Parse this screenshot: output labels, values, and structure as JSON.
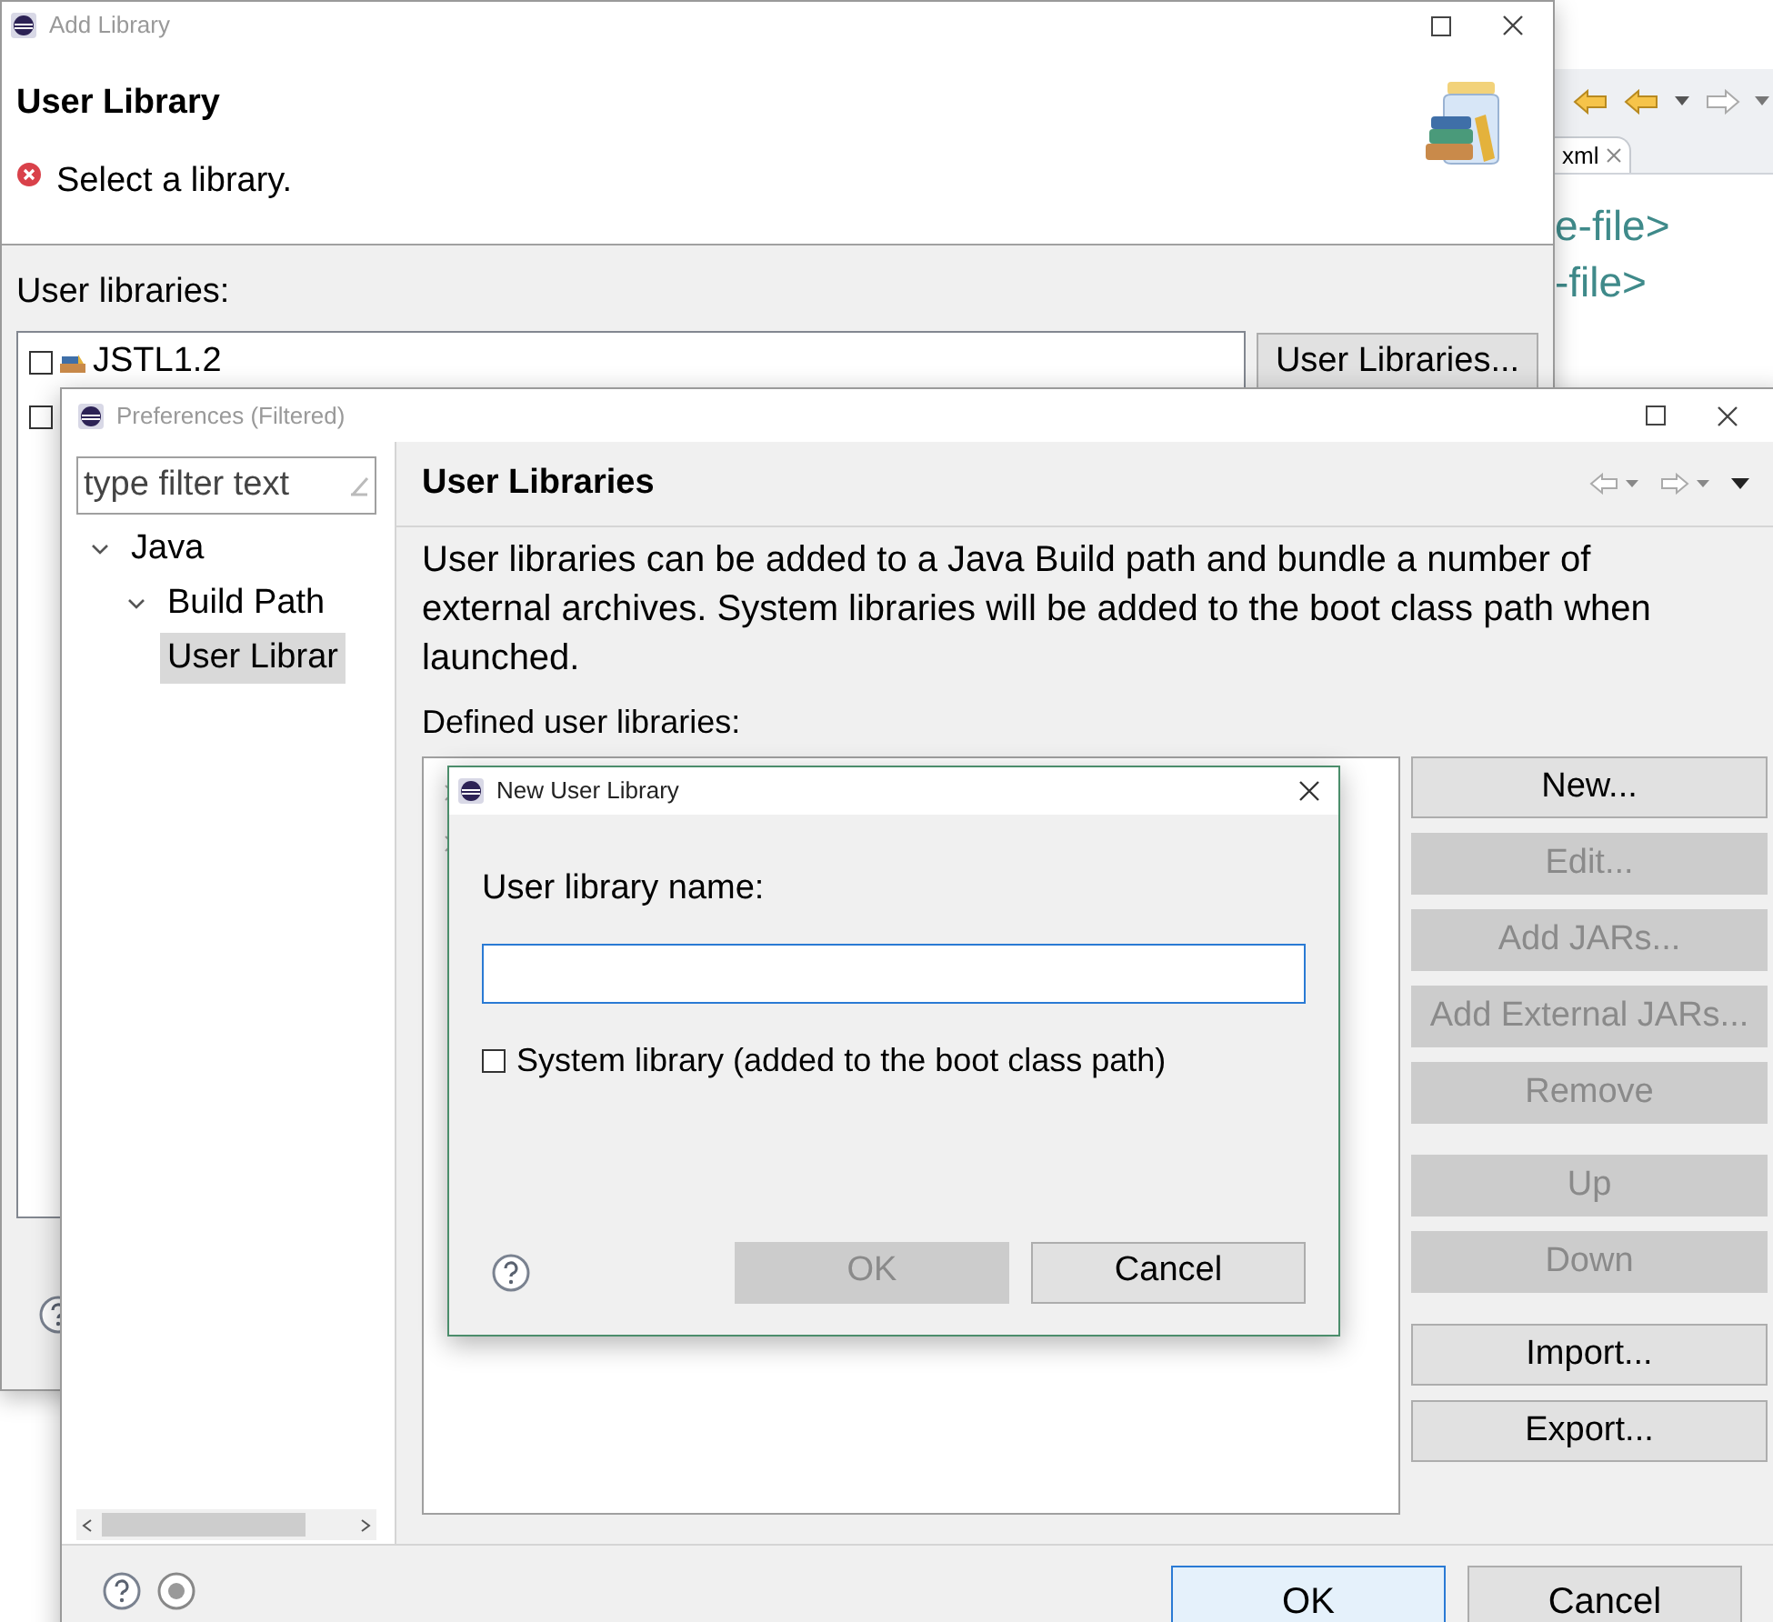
{
  "editor": {
    "tab": {
      "label": "xml"
    },
    "code_lines": [
      "e-file>",
      "-file>"
    ]
  },
  "add_library": {
    "title": "Add Library",
    "heading": "User Library",
    "message": "Select a library.",
    "list_label": "User libraries:",
    "libraries": [
      {
        "name": "JSTL1.2",
        "checked": false
      },
      {
        "checked": false
      }
    ],
    "button": "User Libraries..."
  },
  "preferences": {
    "title": "Preferences (Filtered)",
    "filter": {
      "placeholder": "type filter text"
    },
    "tree": [
      {
        "label": "Java",
        "expanded": true,
        "selected": false,
        "children": [
          {
            "label": "Build Path",
            "expanded": true,
            "selected": false,
            "children": [
              {
                "label": "User Librar",
                "selected": true
              }
            ]
          }
        ]
      }
    ],
    "page_title": "User Libraries",
    "description": "User libraries can be added to a Java Build path and bundle a number of external archives. System libraries will be added to the boot class path when launched.",
    "list_label": "Defined user libraries:",
    "button_groups": [
      [
        {
          "label": "New...",
          "disabled": false
        },
        {
          "label": "Edit...",
          "disabled": true
        },
        {
          "label": "Add JARs...",
          "disabled": true
        },
        {
          "label": "Add External JARs...",
          "disabled": true
        },
        {
          "label": "Remove",
          "disabled": true
        }
      ],
      [
        {
          "label": "Up",
          "disabled": true
        },
        {
          "label": "Down",
          "disabled": true
        }
      ],
      [
        {
          "label": "Import...",
          "disabled": false
        },
        {
          "label": "Export...",
          "disabled": false
        }
      ]
    ],
    "footer_buttons": [
      {
        "label": "OK",
        "default": true
      },
      {
        "label": "Cancel",
        "default": false
      }
    ]
  },
  "new_library_dialog": {
    "title": "New User Library",
    "field_label": "User library name:",
    "name_field": {
      "focused": true
    },
    "checkbox": {
      "label": "System library (added to the boot class path)",
      "checked": false
    },
    "buttons": [
      {
        "label": "OK",
        "disabled": true
      },
      {
        "label": "Cancel",
        "disabled": false
      }
    ]
  }
}
